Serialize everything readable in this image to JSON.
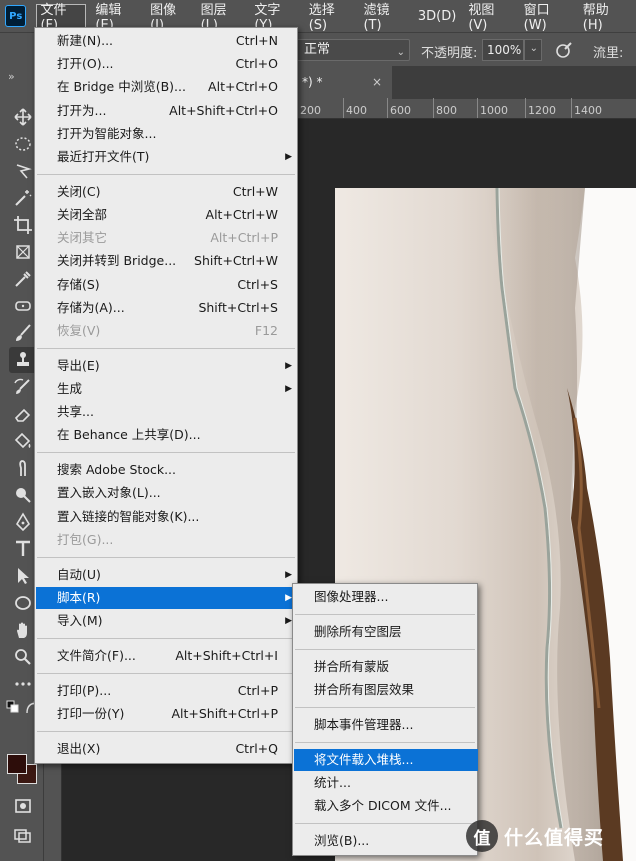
{
  "app": {
    "logo_text": "Ps"
  },
  "menubar": {
    "items": [
      "文件(F)",
      "编辑(E)",
      "图像(I)",
      "图层(L)",
      "文字(Y)",
      "选择(S)",
      "滤镜(T)",
      "3D(D)",
      "视图(V)",
      "窗口(W)",
      "帮助(H)"
    ],
    "active_index": 0
  },
  "options_bar": {
    "blend_mode": "正常",
    "opacity_label": "不透明度:",
    "opacity_value": "100%",
    "flow_label": "流里:"
  },
  "document": {
    "tab_label": "*) *",
    "close_glyph": "×",
    "ruler_ticks": [
      "200",
      "400",
      "600",
      "800",
      "1000",
      "1200",
      "1400"
    ]
  },
  "file_menu": {
    "groups": [
      [
        {
          "label": "新建(N)...",
          "shortcut": "Ctrl+N"
        },
        {
          "label": "打开(O)...",
          "shortcut": "Ctrl+O"
        },
        {
          "label": "在 Bridge 中浏览(B)...",
          "shortcut": "Alt+Ctrl+O"
        },
        {
          "label": "打开为...",
          "shortcut": "Alt+Shift+Ctrl+O"
        },
        {
          "label": "打开为智能对象...",
          "shortcut": ""
        },
        {
          "label": "最近打开文件(T)",
          "shortcut": "",
          "submenu": true
        }
      ],
      [
        {
          "label": "关闭(C)",
          "shortcut": "Ctrl+W"
        },
        {
          "label": "关闭全部",
          "shortcut": "Alt+Ctrl+W"
        },
        {
          "label": "关闭其它",
          "shortcut": "Alt+Ctrl+P",
          "disabled": true
        },
        {
          "label": "关闭并转到 Bridge...",
          "shortcut": "Shift+Ctrl+W"
        },
        {
          "label": "存储(S)",
          "shortcut": "Ctrl+S"
        },
        {
          "label": "存储为(A)...",
          "shortcut": "Shift+Ctrl+S"
        },
        {
          "label": "恢复(V)",
          "shortcut": "F12",
          "disabled": true
        }
      ],
      [
        {
          "label": "导出(E)",
          "shortcut": "",
          "submenu": true
        },
        {
          "label": "生成",
          "shortcut": "",
          "submenu": true
        },
        {
          "label": "共享...",
          "shortcut": ""
        },
        {
          "label": "在 Behance 上共享(D)...",
          "shortcut": ""
        }
      ],
      [
        {
          "label": "搜索 Adobe Stock...",
          "shortcut": ""
        },
        {
          "label": "置入嵌入对象(L)...",
          "shortcut": ""
        },
        {
          "label": "置入链接的智能对象(K)...",
          "shortcut": ""
        },
        {
          "label": "打包(G)...",
          "shortcut": "",
          "disabled": true
        }
      ],
      [
        {
          "label": "自动(U)",
          "shortcut": "",
          "submenu": true
        },
        {
          "label": "脚本(R)",
          "shortcut": "",
          "submenu": true,
          "highlighted": true
        },
        {
          "label": "导入(M)",
          "shortcut": "",
          "submenu": true
        }
      ],
      [
        {
          "label": "文件简介(F)...",
          "shortcut": "Alt+Shift+Ctrl+I"
        }
      ],
      [
        {
          "label": "打印(P)...",
          "shortcut": "Ctrl+P"
        },
        {
          "label": "打印一份(Y)",
          "shortcut": "Alt+Shift+Ctrl+P"
        }
      ],
      [
        {
          "label": "退出(X)",
          "shortcut": "Ctrl+Q"
        }
      ]
    ]
  },
  "script_menu": {
    "groups": [
      [
        {
          "label": "图像处理器..."
        }
      ],
      [
        {
          "label": "删除所有空图层"
        }
      ],
      [
        {
          "label": "拼合所有蒙版"
        },
        {
          "label": "拼合所有图层效果"
        }
      ],
      [
        {
          "label": "脚本事件管理器..."
        }
      ],
      [
        {
          "label": "将文件载入堆栈...",
          "highlighted": true
        },
        {
          "label": "统计..."
        },
        {
          "label": "载入多个 DICOM 文件..."
        }
      ],
      [
        {
          "label": "浏览(B)..."
        }
      ]
    ]
  },
  "watermark": {
    "badge": "值",
    "text": "什么值得买"
  },
  "colors": {
    "menu_bg": "#ececec",
    "highlight": "#0b72d6",
    "foreground_swatch": "#2d0d0a",
    "background_swatch": "#3b1812"
  }
}
